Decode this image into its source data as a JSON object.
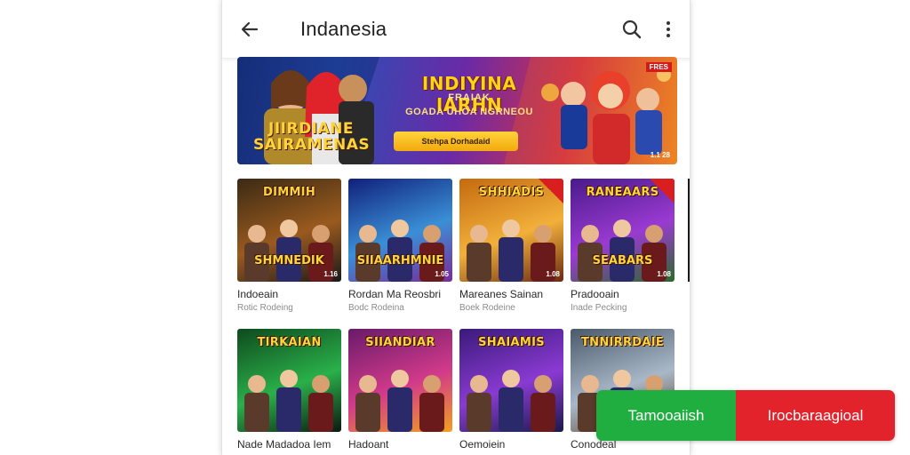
{
  "app_bar": {
    "title": "Indanesia",
    "back_icon": "arrow-back-icon",
    "search_icon": "search-icon",
    "more_icon": "more-vert-icon"
  },
  "banner": {
    "headline": "INDIYINA IARHN",
    "subline1": "FRAIAK",
    "subline2": "GOADA UHOA NGRNEOU",
    "cta_label": "Stehpa Dorhadaid",
    "logo_text": "JIIRDIANE SAIRAMENAS",
    "corner_top": "FRES",
    "corner_bottom": "1.1 28"
  },
  "games_row1": [
    {
      "name": "Indoeain",
      "sub": "Rotic Rodeing",
      "thumb_title": "DIMMIH",
      "logo": "SHMNEDIK",
      "badge": "1.16",
      "corner": false,
      "colors": [
        "#3a2a14",
        "#9a5a1e",
        "#1a1a1a"
      ]
    },
    {
      "name": "Rordan Ma Reosbri",
      "sub": "Bodc Rodeina",
      "thumb_title": "",
      "logo": "SIIAARHMNIE",
      "badge": "1.05",
      "corner": false,
      "colors": [
        "#10207a",
        "#3a8fd6",
        "#7a2a9a"
      ]
    },
    {
      "name": "Mareanes Sainan",
      "sub": "Boek Rodeine",
      "thumb_title": "SHHIADIS",
      "logo": "",
      "badge": "1.08",
      "corner": true,
      "colors": [
        "#c46a10",
        "#f2b03a",
        "#6a2a10"
      ]
    },
    {
      "name": "Pradooain",
      "sub": "Inade Pecking",
      "thumb_title": "RANEAARS",
      "logo": "SEABARS",
      "badge": "1.08",
      "corner": true,
      "colors": [
        "#4a1a8a",
        "#9a3ad2",
        "#2a6a2a"
      ]
    }
  ],
  "games_row2": [
    {
      "name": "Nade Madadoa Iem",
      "sub": "",
      "thumb_title": "TIRKAIAN",
      "logo": "",
      "badge": "",
      "corner": false,
      "colors": [
        "#0e4a1e",
        "#2ab04a",
        "#0a1a10"
      ]
    },
    {
      "name": "Hadoant",
      "sub": "",
      "thumb_title": "SIIANDIAR",
      "logo": "",
      "badge": "",
      "corner": false,
      "colors": [
        "#6a1a6a",
        "#d23a8a",
        "#f2a020"
      ]
    },
    {
      "name": "Oemoiein",
      "sub": "",
      "thumb_title": "SHAIAMIS",
      "logo": "",
      "badge": "",
      "corner": false,
      "colors": [
        "#3a1a7a",
        "#8a3ad2",
        "#1a1a4a"
      ]
    },
    {
      "name": "Conodeal",
      "sub": "",
      "thumb_title": "TNNIRRDAIE",
      "logo": "",
      "badge": "",
      "corner": false,
      "colors": [
        "#4a5a6a",
        "#a8b8c8",
        "#5a3a1a"
      ]
    }
  ],
  "action_buttons": {
    "green_label": "Tamooaiish",
    "red_label": "Irocbaraagioal",
    "green_color": "#1fae3f",
    "red_color": "#e3232b"
  }
}
